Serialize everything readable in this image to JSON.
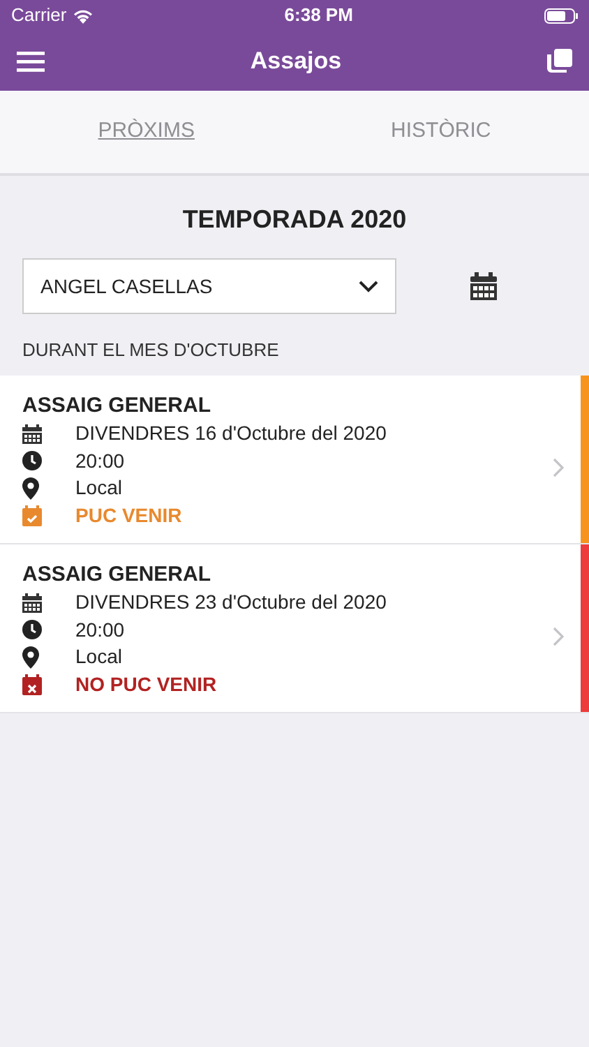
{
  "status_bar": {
    "carrier": "Carrier",
    "time": "6:38 PM"
  },
  "nav": {
    "title": "Assajos"
  },
  "tabs": [
    {
      "label": "PRÒXIMS",
      "selected": true
    },
    {
      "label": "HISTÒRIC",
      "selected": false
    }
  ],
  "season_title": "TEMPORADA 2020",
  "member_select": {
    "value": "ANGEL CASELLAS"
  },
  "month_label": "DURANT EL MES D'OCTUBRE",
  "events": [
    {
      "title": "ASSAIG GENERAL",
      "date": "DIVENDRES 16 d'Octubre del 2020",
      "time": "20:00",
      "place": "Local",
      "attendance": "PUC VENIR",
      "kind": "yes",
      "color": "#f7941d"
    },
    {
      "title": "ASSAIG GENERAL",
      "date": "DIVENDRES 23 d'Octubre del 2020",
      "time": "20:00",
      "place": "Local",
      "attendance": "NO PUC VENIR",
      "kind": "no",
      "color": "#ee3b3b"
    }
  ]
}
